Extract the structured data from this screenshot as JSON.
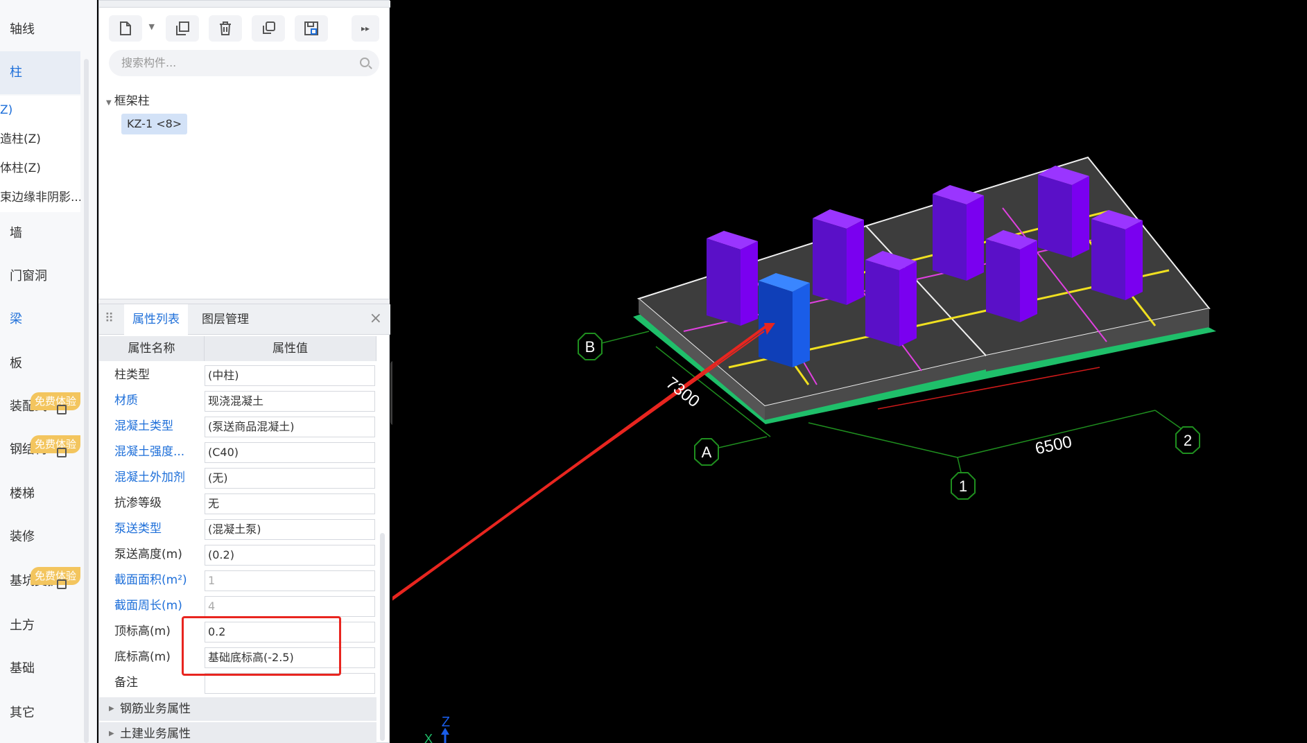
{
  "nav": {
    "items": [
      {
        "label": "轴线"
      },
      {
        "label": "柱"
      },
      {
        "label": "墙"
      },
      {
        "label": "门窗洞"
      },
      {
        "label": "梁"
      },
      {
        "label": "板"
      },
      {
        "label": "装配式"
      },
      {
        "label": "钢结构"
      },
      {
        "label": "楼梯"
      },
      {
        "label": "装修"
      },
      {
        "label": "基坑支护"
      },
      {
        "label": "土方"
      },
      {
        "label": "基础"
      },
      {
        "label": "其它"
      }
    ],
    "subitems": [
      {
        "label": "Z)"
      },
      {
        "label": "造柱(Z)"
      },
      {
        "label": "体柱(Z)"
      },
      {
        "label": "束边缘非阴影..."
      }
    ],
    "badge": "免费体验"
  },
  "component": {
    "search_placeholder": "搜索构件...",
    "tree_root": "框架柱",
    "tree_leaf": "KZ-1 <8>"
  },
  "properties": {
    "tab_active": "属性列表",
    "tab_other": "图层管理",
    "col_name": "属性名称",
    "col_value": "属性值",
    "rows": [
      {
        "name": "柱类型",
        "value": "(中柱)"
      },
      {
        "name": "材质",
        "value": "现浇混凝土"
      },
      {
        "name": "混凝土类型",
        "value": "(泵送商品混凝土)"
      },
      {
        "name": "混凝土强度...",
        "value": "(C40)"
      },
      {
        "name": "混凝土外加剂",
        "value": "(无)"
      },
      {
        "name": "抗渗等级",
        "value": "无"
      },
      {
        "name": "泵送类型",
        "value": "(混凝土泵)"
      },
      {
        "name": "泵送高度(m)",
        "value": "(0.2)"
      },
      {
        "name": "截面面积(m²)",
        "value": "1"
      },
      {
        "name": "截面周长(m)",
        "value": "4"
      },
      {
        "name": "顶标高(m)",
        "value": "0.2"
      },
      {
        "name": "底标高(m)",
        "value": "基础底标高(-2.5)"
      },
      {
        "name": "备注",
        "value": ""
      }
    ],
    "groups": [
      "钢筋业务属性",
      "土建业务属性"
    ]
  },
  "viewport": {
    "axis_labels": {
      "a": "A",
      "b": "B",
      "one": "1",
      "two": "2"
    },
    "dim_long": "6500",
    "dim_short": "7300",
    "gizmo_z": "Z",
    "gizmo_x": "X",
    "colors": {
      "column": "#7a00f0",
      "column_selected": "#1a5de8",
      "slab": "#3d3d3d",
      "outline": "#f0f0f0",
      "base": "#1fbf6a",
      "grid_line": "#1f8f1f",
      "beam_yellow": "#f0e020",
      "beam_magenta": "#e040e0",
      "arrow": "#e8251f"
    }
  }
}
